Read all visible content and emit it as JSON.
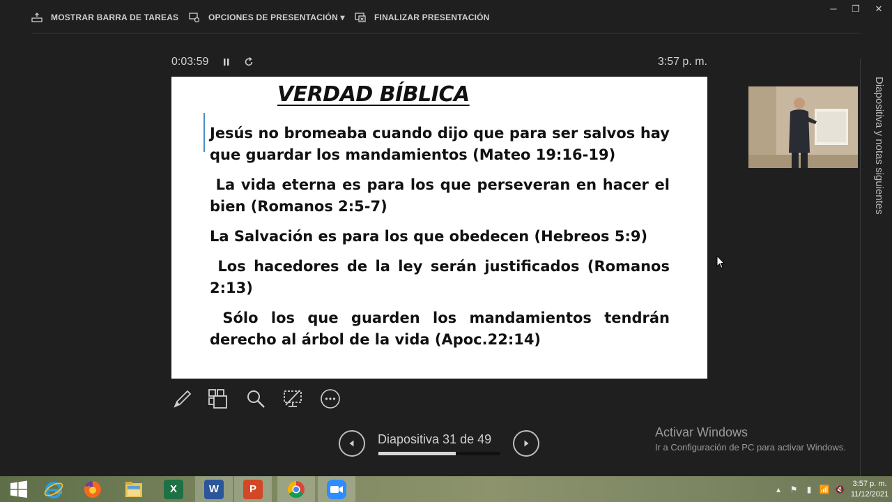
{
  "toolbar": {
    "taskbar_label": "MOSTRAR BARRA DE TAREAS",
    "options_label": "OPCIONES DE PRESENTACIÓN ▾",
    "end_label": "FINALIZAR PRESENTACIÓN"
  },
  "window": {
    "minimize": "─",
    "restore": "❐",
    "close": "✕"
  },
  "timer": {
    "elapsed": "0:03:59",
    "clock": "3:57 p. m."
  },
  "slide": {
    "title": "VERDAD BÍBLICA",
    "bullets": [
      "Jesús no bromeaba cuando dijo que para ser salvos hay que guardar los mandamientos (Mateo 19:16-19)",
      " La vida eterna es para los que perseveran en hacer el bien (Romanos 2:5-7)",
      "La Salvación es para los que obedecen (Hebreos 5:9)",
      " Los hacedores de la ley serán justificados (Romanos 2:13)",
      " Sólo los que guarden los mandamientos tendrán derecho al árbol de la vida (Apoc.22:14)"
    ]
  },
  "navigation": {
    "counter": "Diapositiva 31 de 49",
    "current": 31,
    "total": 49
  },
  "side_panel": {
    "label": "Diapositiva y notas siguientes"
  },
  "watermark": {
    "title": "Activar Windows",
    "subtitle": "Ir a Configuración de PC para activar Windows."
  },
  "taskbar": {
    "apps": [
      {
        "name": "windows-start",
        "glyph": ""
      },
      {
        "name": "internet-explorer",
        "glyph": "e",
        "color": "#1f8fd6"
      },
      {
        "name": "firefox",
        "glyph": "",
        "color": "#e8671b"
      },
      {
        "name": "file-explorer",
        "glyph": "",
        "color": "#e8c45a"
      },
      {
        "name": "excel",
        "glyph": "X",
        "color": "#1e7145"
      },
      {
        "name": "word",
        "glyph": "W",
        "color": "#2b579a"
      },
      {
        "name": "powerpoint",
        "glyph": "P",
        "color": "#d24726"
      },
      {
        "name": "chrome",
        "glyph": "",
        "color": "#e9b43a"
      },
      {
        "name": "zoom",
        "glyph": "",
        "color": "#2d8cff"
      }
    ],
    "time": "3:57 p. m.",
    "date": "11/12/2021"
  }
}
